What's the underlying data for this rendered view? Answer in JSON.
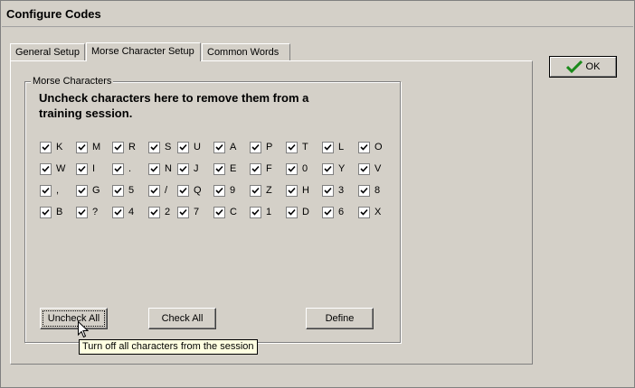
{
  "window": {
    "title": "Configure Codes"
  },
  "tabs": [
    {
      "label": "General Setup"
    },
    {
      "label": "Morse Character Setup"
    },
    {
      "label": "Common Words"
    }
  ],
  "ok_button": {
    "label": "OK",
    "icon": "checkmark-icon"
  },
  "group": {
    "legend": "Morse Characters",
    "instructions": "Uncheck characters here to remove them from a training session."
  },
  "characters": [
    [
      "K",
      "M",
      "R",
      "S",
      "U",
      "A",
      "P",
      "T",
      "L",
      "O"
    ],
    [
      "W",
      "I",
      ".",
      "N",
      "J",
      "E",
      "F",
      "0",
      "Y",
      "V"
    ],
    [
      ",",
      "G",
      "5",
      "/",
      "Q",
      "9",
      "Z",
      "H",
      "3",
      "8"
    ],
    [
      "B",
      "?",
      "4",
      "2",
      "7",
      "C",
      "1",
      "D",
      "6",
      "X"
    ]
  ],
  "all_checked": true,
  "buttons": {
    "uncheck_all": "Uncheck All",
    "check_all": "Check All",
    "define": "Define"
  },
  "tooltip": "Turn off all characters from the session"
}
